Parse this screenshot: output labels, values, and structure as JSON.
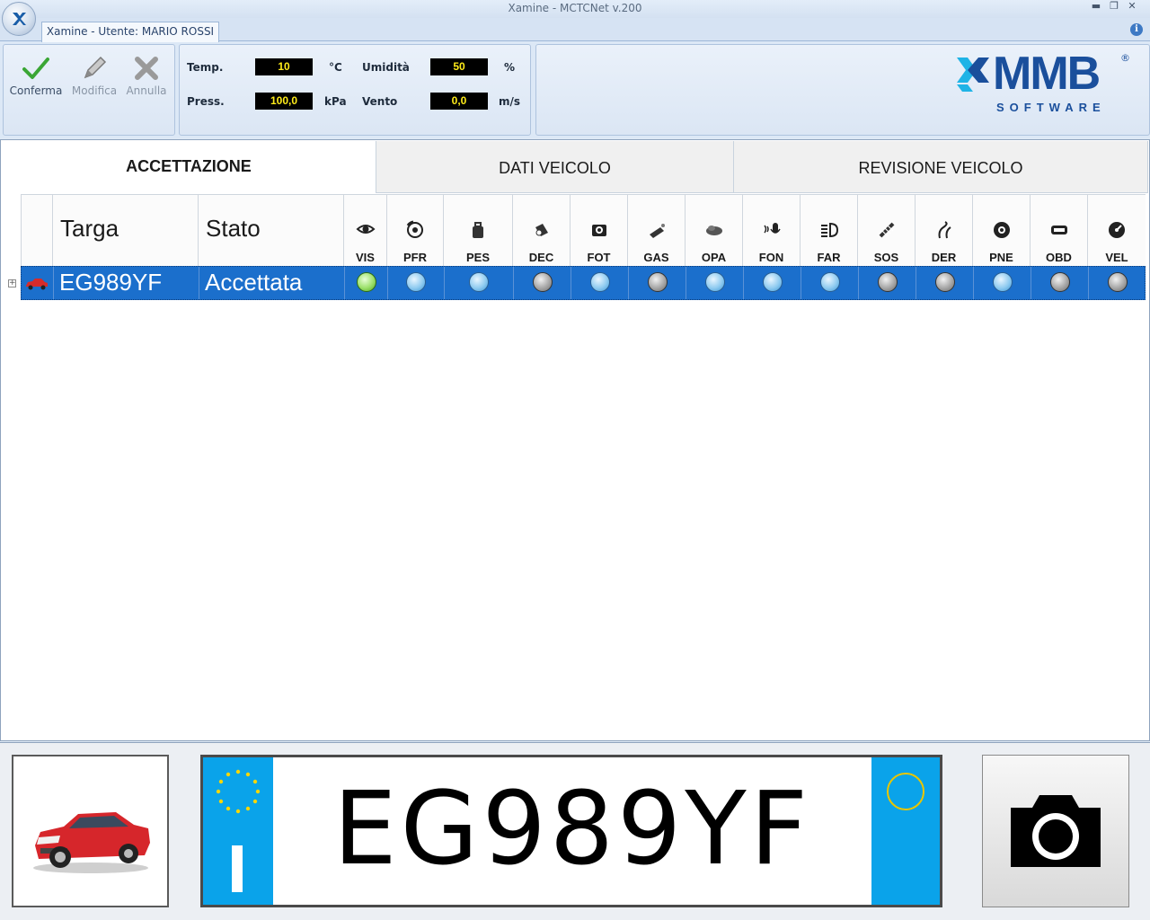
{
  "window": {
    "title": "Xamine - MCTCNet v.200"
  },
  "ribbon": {
    "user_tab": "Xamine - Utente: MARIO ROSSI",
    "actions": [
      {
        "label": "Conferma",
        "icon": "check-icon",
        "enabled": true
      },
      {
        "label": "Modifica",
        "icon": "pencil-icon",
        "enabled": false
      },
      {
        "label": "Annulla",
        "icon": "cross-icon",
        "enabled": false
      }
    ],
    "env": {
      "temp_label": "Temp.",
      "temp_value": "10",
      "temp_unit": "°C",
      "press_label": "Press.",
      "press_value": "100,0",
      "press_unit": "kPa",
      "hum_label": "Umidità",
      "hum_value": "50",
      "hum_unit": "%",
      "wind_label": "Vento",
      "wind_value": "0,0",
      "wind_unit": "m/s"
    },
    "logo": {
      "name": "MMB",
      "sub": "SOFTWARE",
      "reg": "®"
    }
  },
  "tabs": [
    {
      "label": "ACCETTAZIONE",
      "active": true
    },
    {
      "label": "DATI VEICOLO",
      "active": false
    },
    {
      "label": "REVISIONE VEICOLO",
      "active": false
    }
  ],
  "grid": {
    "headers": {
      "plate": "Targa",
      "state": "Stato"
    },
    "checks": [
      {
        "code": "VIS",
        "icon": "eye-icon"
      },
      {
        "code": "PFR",
        "icon": "brake-icon"
      },
      {
        "code": "PES",
        "icon": "weight-icon"
      },
      {
        "code": "DEC",
        "icon": "decibel-icon"
      },
      {
        "code": "FOT",
        "icon": "photo-icon"
      },
      {
        "code": "GAS",
        "icon": "exhaust-icon"
      },
      {
        "code": "OPA",
        "icon": "smoke-icon"
      },
      {
        "code": "FON",
        "icon": "microphone-icon"
      },
      {
        "code": "FAR",
        "icon": "headlight-icon"
      },
      {
        "code": "SOS",
        "icon": "suspension-icon"
      },
      {
        "code": "DER",
        "icon": "road-icon"
      },
      {
        "code": "PNE",
        "icon": "tire-icon"
      },
      {
        "code": "OBD",
        "icon": "obd-icon"
      },
      {
        "code": "VEL",
        "icon": "speedometer-icon"
      }
    ],
    "rows": [
      {
        "plate": "EG989YF",
        "state": "Accettata",
        "statuses": [
          "green",
          "blue",
          "blue",
          "gray",
          "blue",
          "gray",
          "blue",
          "blue",
          "blue",
          "gray",
          "gray",
          "blue",
          "gray",
          "gray"
        ]
      }
    ]
  },
  "bottom": {
    "plate_text": "EG989YF",
    "plate_country": "I"
  },
  "colors": {
    "selection": "#1b6fcc",
    "plate_band": "#0aa3ea",
    "env_value_text": "#ffec1a"
  }
}
